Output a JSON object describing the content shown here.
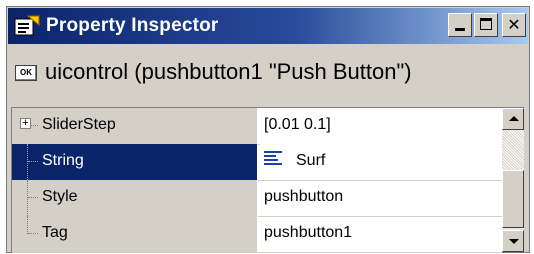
{
  "window": {
    "title": "Property Inspector",
    "controls": {
      "minimize": "minimize",
      "maximize": "maximize",
      "close": "✕"
    }
  },
  "object": {
    "icon_label": "OK",
    "description": "uicontrol (pushbutton1 \"Push Button\")"
  },
  "properties": [
    {
      "name": "SliderStep",
      "value": "[0.01 0.1]",
      "expandable": true,
      "selected": false,
      "dimmed": true
    },
    {
      "name": "String",
      "value": "Surf",
      "expandable": false,
      "selected": true,
      "dimmed": false
    },
    {
      "name": "Style",
      "value": "pushbutton",
      "expandable": false,
      "selected": false,
      "dimmed": false
    },
    {
      "name": "Tag",
      "value": "pushbutton1",
      "expandable": false,
      "selected": false,
      "dimmed": false
    }
  ],
  "colors": {
    "titlebar_start": "#0a246a",
    "titlebar_end": "#a6caf0",
    "selection": "#0a246a",
    "panel": "#d4d0c8"
  },
  "icons": {
    "title": "property-inspector-icon",
    "object": "pushbutton-icon",
    "string_value": "text-lines-icon"
  }
}
